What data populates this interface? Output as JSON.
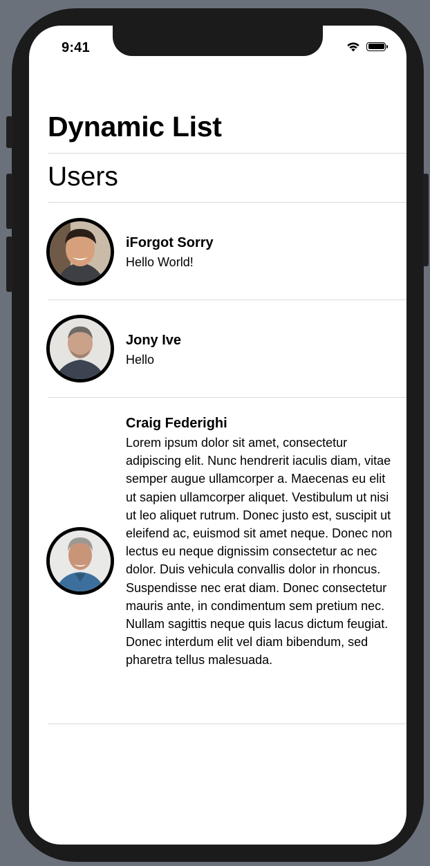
{
  "status_bar": {
    "time": "9:41",
    "icons": [
      "wifi-icon",
      "battery-icon"
    ]
  },
  "nav": {
    "title": "Dynamic List"
  },
  "section": {
    "header": "Users"
  },
  "users": [
    {
      "name": "iForgot Sorry",
      "message": "Hello World!",
      "avatar": "avatar-photo-smiling-man"
    },
    {
      "name": "Jony Ive",
      "message": "Hello",
      "avatar": "avatar-photo-jony-ive"
    },
    {
      "name": "Craig Federighi",
      "message": "Lorem ipsum dolor sit amet, consectetur adipiscing elit. Nunc hendrerit iaculis diam, vitae semper augue ullamcorper a. Maecenas eu elit ut sapien ullamcorper aliquet. Vestibulum ut nisi ut leo aliquet rutrum. Donec justo est, suscipit ut eleifend ac, euismod sit amet neque. Donec non lectus eu neque dignissim consectetur ac nec dolor. Duis vehicula convallis dolor in rhoncus. Suspendisse nec erat diam. Donec consectetur mauris ante, in condimentum sem pretium nec. Nullam sagittis neque quis lacus dictum feugiat. Donec interdum elit vel diam bibendum, sed pharetra tellus malesuada.",
      "avatar": "avatar-photo-craig-federighi"
    }
  ],
  "colors": {
    "background": "#6b717b",
    "device_frame": "#1b1b1c",
    "screen": "#ffffff",
    "separator": "#d9d9dc",
    "text": "#000000"
  }
}
